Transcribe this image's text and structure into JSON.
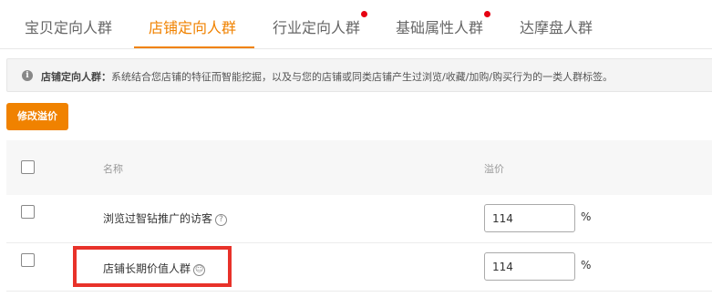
{
  "tabs": [
    {
      "label": "宝贝定向人群",
      "active": false,
      "dot": false
    },
    {
      "label": "店铺定向人群",
      "active": true,
      "dot": false
    },
    {
      "label": "行业定向人群",
      "active": false,
      "dot": true
    },
    {
      "label": "基础属性人群",
      "active": false,
      "dot": true
    },
    {
      "label": "达摩盘人群",
      "active": false,
      "dot": false
    }
  ],
  "notice": {
    "icon": "info-icon",
    "title": "店铺定向人群：",
    "text": "系统结合您店铺的特征而智能挖掘，以及与您的店铺或同类店铺产生过浏览/收藏/加购/购买行为的一类人群标签。"
  },
  "toolbar": {
    "modify_label": "修改溢价"
  },
  "table": {
    "columns": {
      "name": "名称",
      "premium": "溢价"
    },
    "rows": [
      {
        "name": "浏览过智钻推广的访客",
        "icon": "question-circle-icon",
        "value": "114",
        "unit": "%"
      },
      {
        "name": "店铺长期价值人群",
        "icon": "user-circle-icon",
        "value": "114",
        "unit": "%"
      }
    ]
  },
  "colors": {
    "accent": "#f08200",
    "dot": "#e60012",
    "highlight": "#e8322a"
  }
}
